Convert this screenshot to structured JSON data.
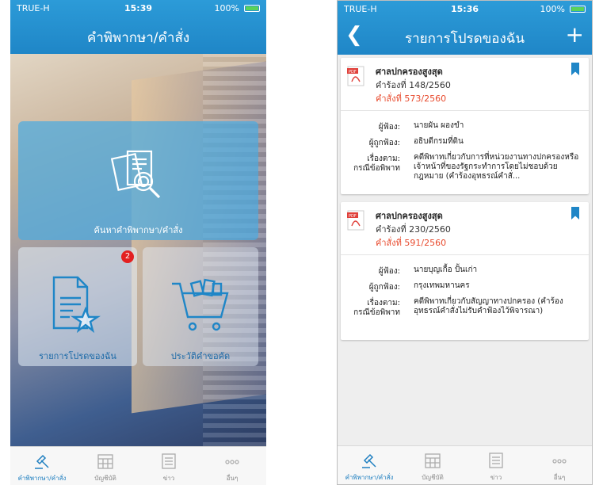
{
  "status_left": {
    "carrier": "TRUE-H",
    "time": "15:39",
    "battery": "100%"
  },
  "status_right": {
    "carrier": "TRUE-H",
    "time": "15:36",
    "battery": "100%"
  },
  "home": {
    "title": "คำพิพากษา/คำสั่ง",
    "tiles": {
      "search": "ค้นหาคำพิพากษา/คำสั่ง",
      "favorites": "รายการโปรดของฉัน",
      "favorites_badge": "2",
      "history": "ประวัติคำขอคัด"
    }
  },
  "favorites": {
    "title": "รายการโปรดของฉัน",
    "cards": [
      {
        "court": "ศาลปกครองสูงสุด",
        "request_label": "คำร้องที่",
        "request_no": "148/2560",
        "order_label": "คำสั่งที่",
        "order_no": "573/2560",
        "plaintiff_label": "ผู้ฟ้อง:",
        "plaintiff": "นายผัน ผองขำ",
        "defendant_label": "ผู้ถูกฟ้อง:",
        "defendant": "อธิบดีกรมที่ดิน",
        "subject_label_1": "เรื่องตาม:",
        "subject_label_2": "กรณีข้อพิพาท",
        "subject": "คดีพิพาทเกี่ยวกับการที่หน่วยงานทางปกครองหรือเจ้าหน้าที่ของรัฐกระทำการโดยไม่ชอบด้วยกฎหมาย (คำร้องอุทธรณ์คำสั่..."
      },
      {
        "court": "ศาลปกครองสูงสุด",
        "request_label": "คำร้องที่",
        "request_no": "230/2560",
        "order_label": "คำสั่งที่",
        "order_no": "591/2560",
        "plaintiff_label": "ผู้ฟ้อง:",
        "plaintiff": "นายบุญเกื้อ ปั้นเก่า",
        "defendant_label": "ผู้ถูกฟ้อง:",
        "defendant": "กรุงเทพมหานคร",
        "subject_label_1": "เรื่องตาม:",
        "subject_label_2": "กรณีข้อพิพาท",
        "subject": "คดีพิพาทเกี่ยวกับสัญญาทางปกครอง (คำร้องอุทธรณ์คำสั่งไม่รับคำฟ้องไว้พิจารณา)"
      }
    ]
  },
  "tabs": [
    {
      "label": "คำพิพากษา/คำสั่ง",
      "icon": "gavel-icon"
    },
    {
      "label": "บัญชีบัติ",
      "icon": "calendar-icon"
    },
    {
      "label": "ข่าว",
      "icon": "news-icon"
    },
    {
      "label": "อื่นๆ",
      "icon": "more-icon"
    }
  ],
  "colors": {
    "accent": "#1f86c7",
    "order": "#e84a2d",
    "badge": "#e32020"
  }
}
